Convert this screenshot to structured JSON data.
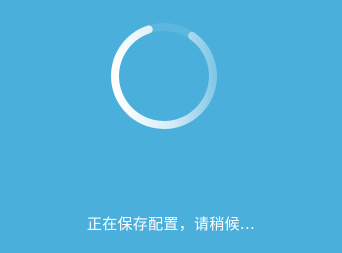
{
  "dialog": {
    "status_text": "正在保存配置，请稍候..."
  },
  "spinner": {
    "icon": "loading-spinner-icon"
  },
  "colors": {
    "background": "#4aafdb",
    "text": "#ffffff",
    "spinner": "#ffffff"
  }
}
